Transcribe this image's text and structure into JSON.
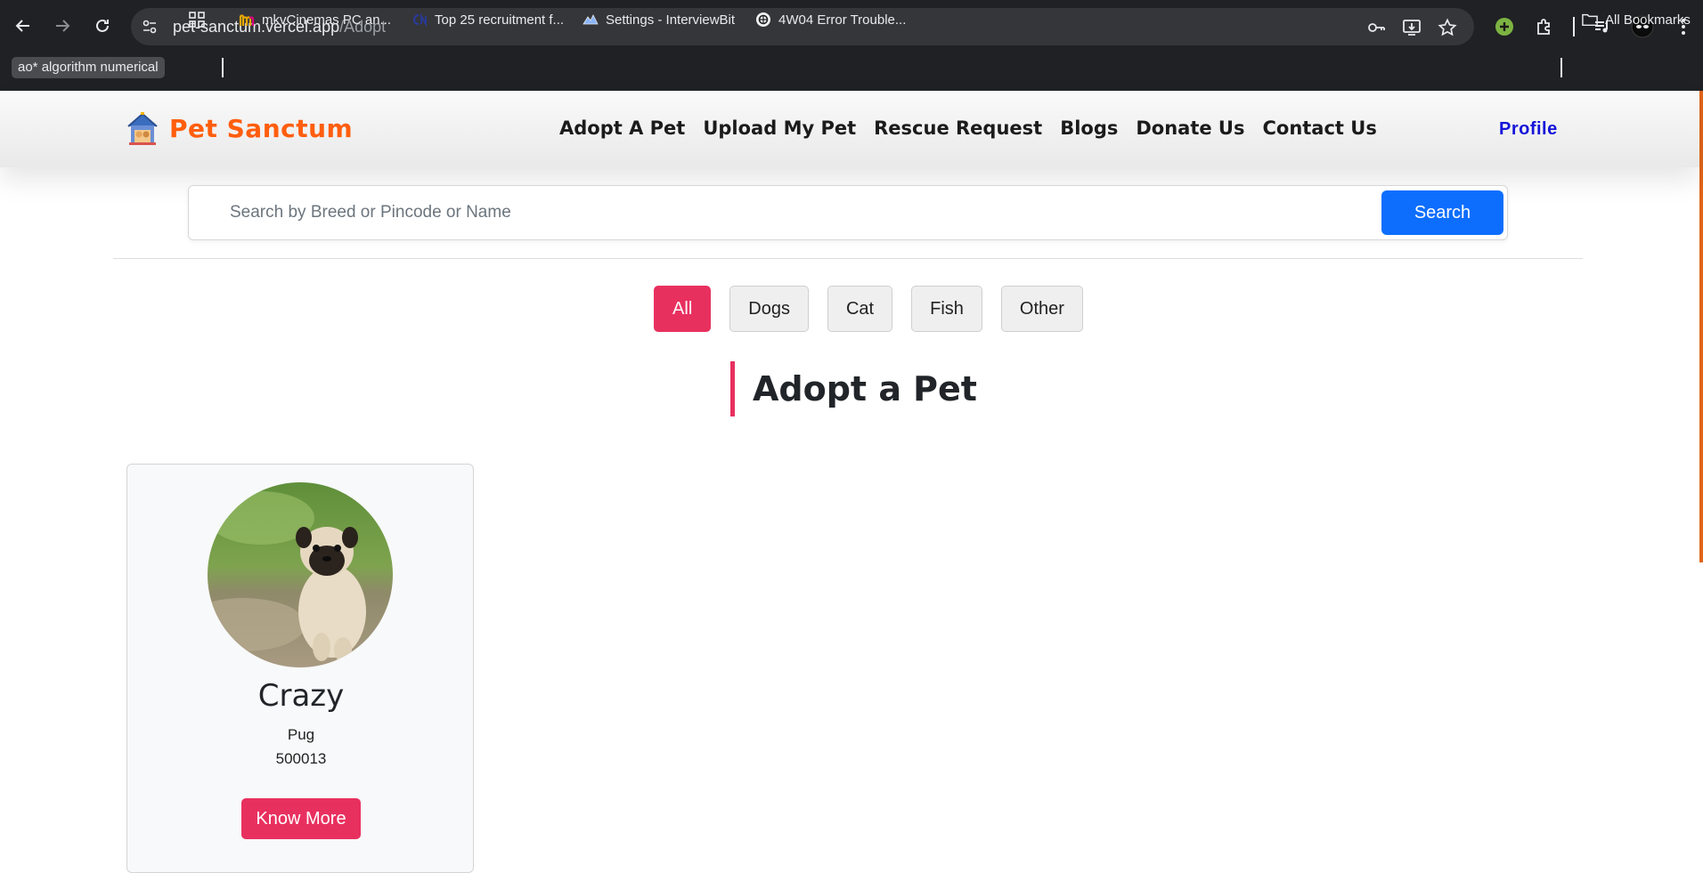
{
  "browser": {
    "url_host": "pet-sanctum.vercel.app",
    "url_path": "/Adopt",
    "bookmarks": [
      {
        "label": "ao* algorithm numerical",
        "icon": "chip"
      },
      {
        "label": "",
        "icon": "apps-grid-icon"
      },
      {
        "label": "mkvCinemas PC an...",
        "icon": "mkv-logo-icon"
      },
      {
        "label": "Top 25 recruitment f...",
        "icon": "cn-logo-icon"
      },
      {
        "label": "Settings - InterviewBit",
        "icon": "interviewbit-icon"
      },
      {
        "label": "4W04 Error Trouble...",
        "icon": "openai-icon"
      }
    ],
    "all_bookmarks_label": "All Bookmarks"
  },
  "site": {
    "brand": "Pet Sanctum",
    "nav": [
      "Adopt A Pet",
      "Upload My Pet",
      "Rescue Request",
      "Blogs",
      "Donate Us",
      "Contact Us"
    ],
    "profile_label": "Profile"
  },
  "search": {
    "placeholder": "Search by Breed or Pincode or Name",
    "button_label": "Search"
  },
  "filters": {
    "items": [
      "All",
      "Dogs",
      "Cat",
      "Fish",
      "Other"
    ],
    "active": "All"
  },
  "section_title": "Adopt a Pet",
  "pets": [
    {
      "name": "Crazy",
      "breed": "Pug",
      "pincode": "500013",
      "button_label": "Know More"
    }
  ],
  "colors": {
    "brand_orange": "#ff5e0e",
    "accent_pink": "#e8305f",
    "primary_blue": "#0d6efd",
    "profile_blue": "#1414d9"
  }
}
